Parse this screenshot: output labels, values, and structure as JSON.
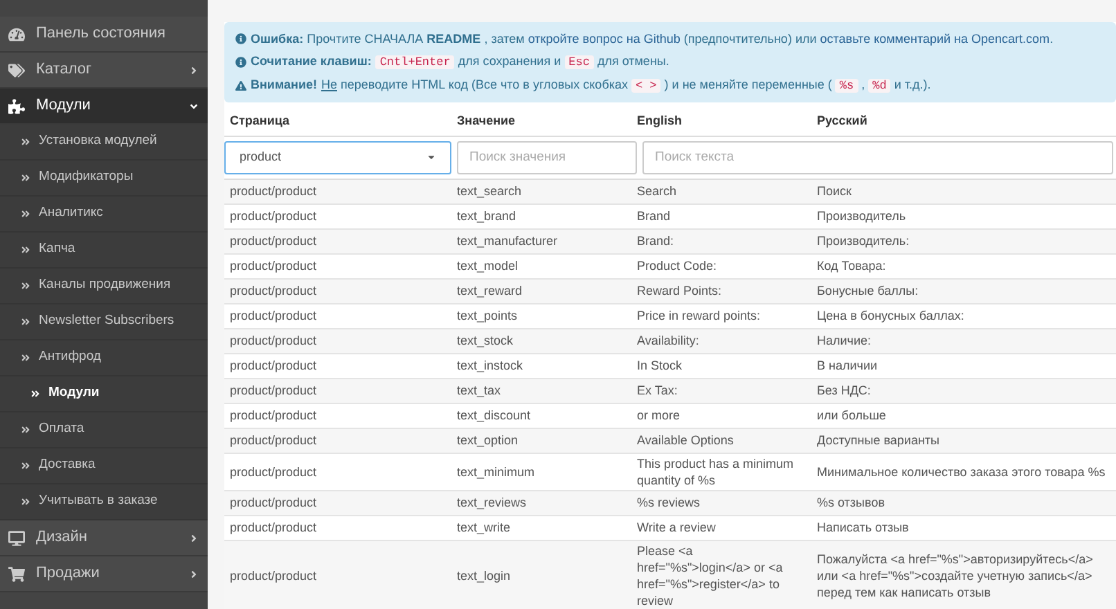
{
  "sidebar": {
    "items": [
      {
        "label": "Панель состояния",
        "selected": false
      },
      {
        "label": "Каталог",
        "selected": false,
        "expanded": false
      },
      {
        "label": "Модули",
        "selected": true,
        "expanded": true,
        "children": [
          {
            "label": "Установка модулей",
            "selected": false
          },
          {
            "label": "Модификаторы",
            "selected": false
          },
          {
            "label": "Аналитикс",
            "selected": false
          },
          {
            "label": "Капча",
            "selected": false
          },
          {
            "label": "Каналы продвижения",
            "selected": false
          },
          {
            "label": "Newsletter Subscribers",
            "selected": false
          },
          {
            "label": "Антифрод",
            "selected": false
          },
          {
            "label": "Модули",
            "selected": true
          },
          {
            "label": "Оплата",
            "selected": false
          },
          {
            "label": "Доставка",
            "selected": false
          },
          {
            "label": "Учитывать в заказе",
            "selected": false
          }
        ]
      },
      {
        "label": "Дизайн",
        "selected": false,
        "expanded": false
      },
      {
        "label": "Продажи",
        "selected": false,
        "expanded": false
      }
    ]
  },
  "alert": {
    "lines": [
      {
        "kind": "info",
        "parts": [
          {
            "kind": "bold",
            "text": "Ошибка:"
          },
          {
            "kind": "text",
            "text": " Прочтите СНАЧАЛА "
          },
          {
            "kind": "bold",
            "text": "README"
          },
          {
            "kind": "text",
            "text": " , затем "
          },
          {
            "kind": "link",
            "text": "откройте вопрос на Github"
          },
          {
            "kind": "text",
            "text": " (предпочтительно) или "
          },
          {
            "kind": "link",
            "text": "оставьте комментарий на Opencart.com"
          },
          {
            "kind": "text",
            "text": "."
          }
        ]
      },
      {
        "kind": "info",
        "parts": [
          {
            "kind": "bold",
            "text": "Сочитание клавиш:"
          },
          {
            "kind": "space"
          },
          {
            "kind": "code",
            "text": "Cntl+Enter"
          },
          {
            "kind": "text",
            "text": " для сохранения и "
          },
          {
            "kind": "code",
            "text": "Esc"
          },
          {
            "kind": "text",
            "text": " для отмены."
          }
        ]
      },
      {
        "kind": "warning",
        "parts": [
          {
            "kind": "bold",
            "text": "Внимание!"
          },
          {
            "kind": "space"
          },
          {
            "kind": "underline",
            "text": "Не"
          },
          {
            "kind": "text",
            "text": " переводите HTML код (Все что в угловых скобках "
          },
          {
            "kind": "code",
            "text": "< >"
          },
          {
            "kind": "text",
            "text": " ) и не меняйте переменные ( "
          },
          {
            "kind": "code",
            "text": "%s"
          },
          {
            "kind": "text",
            "text": " , "
          },
          {
            "kind": "code",
            "text": "%d"
          },
          {
            "kind": "text",
            "text": " и т.д.)."
          }
        ]
      }
    ]
  },
  "table": {
    "columns": [
      "Страница",
      "Значение",
      "English",
      "Русский"
    ],
    "filters": {
      "page": {
        "value": "product"
      },
      "key": {
        "placeholder": "Поиск значения"
      },
      "text": {
        "placeholder": "Поиск текста"
      }
    },
    "rows": [
      {
        "page": "product/product",
        "key": "text_search",
        "english": "Search",
        "russian": "Поиск"
      },
      {
        "page": "product/product",
        "key": "text_brand",
        "english": "Brand",
        "russian": "Производитель"
      },
      {
        "page": "product/product",
        "key": "text_manufacturer",
        "english": "Brand:",
        "russian": "Производитель:"
      },
      {
        "page": "product/product",
        "key": "text_model",
        "english": "Product Code:",
        "russian": "Код Товара:"
      },
      {
        "page": "product/product",
        "key": "text_reward",
        "english": "Reward Points:",
        "russian": "Бонусные баллы:"
      },
      {
        "page": "product/product",
        "key": "text_points",
        "english": "Price in reward points:",
        "russian": "Цена в бонусных баллах:"
      },
      {
        "page": "product/product",
        "key": "text_stock",
        "english": "Availability:",
        "russian": "Наличие:"
      },
      {
        "page": "product/product",
        "key": "text_instock",
        "english": "In Stock",
        "russian": "В наличии"
      },
      {
        "page": "product/product",
        "key": "text_tax",
        "english": "Ex Tax:",
        "russian": "Без НДС:"
      },
      {
        "page": "product/product",
        "key": "text_discount",
        "english": "or more",
        "russian": "или больше"
      },
      {
        "page": "product/product",
        "key": "text_option",
        "english": "Available Options",
        "russian": "Доступные варианты"
      },
      {
        "page": "product/product",
        "key": "text_minimum",
        "english": "This product has a minimum quantity of %s",
        "russian": "Минимальное количество заказа этого товара %s"
      },
      {
        "page": "product/product",
        "key": "text_reviews",
        "english": "%s reviews",
        "russian": "%s отзывов"
      },
      {
        "page": "product/product",
        "key": "text_write",
        "english": "Write a review",
        "russian": "Написать отзыв"
      },
      {
        "page": "product/product",
        "key": "text_login",
        "english": "Please <a href=\"%s\">login</a> or <a href=\"%s\">register</a> to review",
        "russian": "Пожалуйста <a href=\"%s\">авторизируйтесь</a> или <a href=\"%s\">создайте учетную запись</a> перед тем как написать отзыв"
      }
    ]
  }
}
